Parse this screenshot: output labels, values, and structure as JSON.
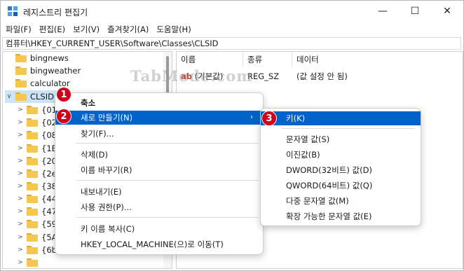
{
  "window": {
    "title": "레지스트리 편집기",
    "controls": {
      "minimize": "—",
      "maximize": "☐",
      "close": "✕"
    }
  },
  "menubar": {
    "items": [
      "파일(F)",
      "편집(E)",
      "보기(V)",
      "즐겨찾기(A)",
      "도움말(H)"
    ]
  },
  "address": "컴퓨터\\HKEY_CURRENT_USER\\Software\\Classes\\CLSID",
  "tree": {
    "items": [
      {
        "label": "bingnews",
        "expandable": false
      },
      {
        "label": "bingweather",
        "expandable": false
      },
      {
        "label": "calculator",
        "expandable": false
      },
      {
        "label": "CLSID",
        "expandable": true,
        "expanded": true,
        "selected": true
      }
    ],
    "children": [
      "{01",
      "{02",
      "{08",
      "{1B",
      "{20",
      "{2e",
      "{38",
      "{44",
      "{47",
      "{59",
      "{5A",
      "{6b",
      ""
    ]
  },
  "values_pane": {
    "columns": [
      "이름",
      "종류",
      "데이터"
    ],
    "rows": [
      {
        "name": "(기본값)",
        "type": "REG_SZ",
        "data": "(값 설정 안 됨)"
      }
    ]
  },
  "watermark": "TabMode.com",
  "context_menu": {
    "items": [
      {
        "label": "축소"
      },
      {
        "label": "새로 만들기(N)",
        "submenu": true,
        "highlighted": true
      },
      {
        "label": "찾기(F)..."
      },
      {
        "label": "삭제(D)"
      },
      {
        "label": "이름 바꾸기(R)"
      },
      {
        "label": "내보내기(E)"
      },
      {
        "label": "사용 권한(P)..."
      },
      {
        "label": "키 이름 복사(C)"
      },
      {
        "label": "HKEY_LOCAL_MACHINE(으)로 이동(T)"
      }
    ],
    "submenu_arrow": "›"
  },
  "submenu": {
    "items": [
      {
        "label": "키(K)",
        "highlighted": true
      },
      {
        "label": "문자열 값(S)"
      },
      {
        "label": "이진값(B)"
      },
      {
        "label": "DWORD(32비트) 값(D)"
      },
      {
        "label": "QWORD(64비트) 값(Q)"
      },
      {
        "label": "다중 문자열 값(M)"
      },
      {
        "label": "확장 가능한 문자열 값(E)"
      }
    ]
  },
  "badges": [
    "1",
    "2",
    "3"
  ],
  "colors": {
    "highlight": "#0063c9",
    "badge": "#d0021b",
    "folder": "#f5c750"
  }
}
